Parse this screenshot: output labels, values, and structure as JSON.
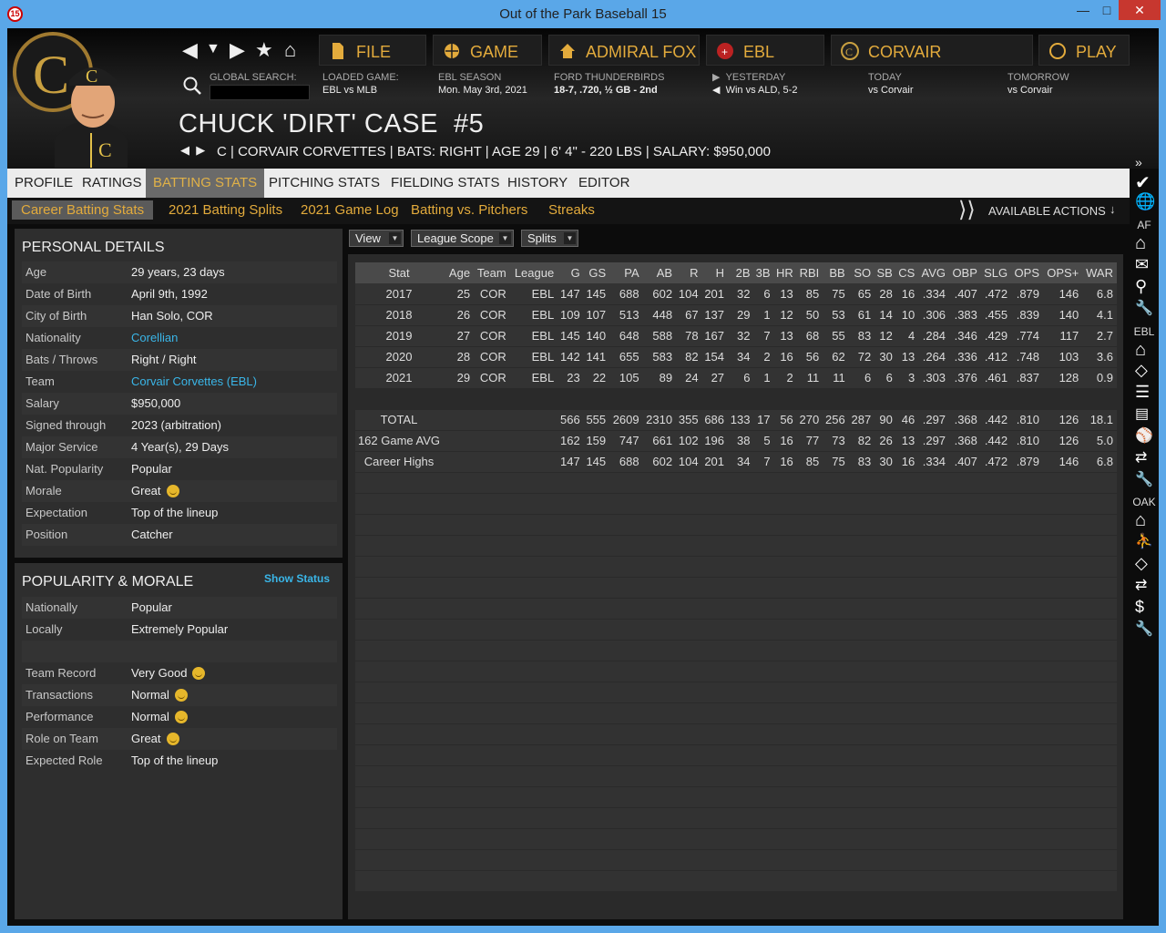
{
  "window": {
    "title": "Out of the Park Baseball 15",
    "app_icon": "15"
  },
  "menu": [
    {
      "label": "FILE",
      "icon": "file-icon"
    },
    {
      "label": "GAME",
      "icon": "globe-icon"
    },
    {
      "label": "ADMIRAL FOX",
      "icon": "home-icon"
    },
    {
      "label": "EBL",
      "icon": "league-logo-icon"
    },
    {
      "label": "CORVAIR",
      "icon": "team-logo-icon"
    },
    {
      "label": "PLAY",
      "icon": "play-icon"
    }
  ],
  "info": {
    "search_label": "GLOBAL SEARCH:",
    "loaded_label": "LOADED GAME:",
    "loaded_value": "EBL vs MLB",
    "season_label": "EBL SEASON",
    "season_value": "Mon. May 3rd, 2021",
    "team_label": "FORD THUNDERBIRDS",
    "team_value": "18-7, .720, ½ GB - 2nd",
    "yesterday_label": "YESTERDAY",
    "yesterday_value": "Win vs ALD, 5-2",
    "today_label": "TODAY",
    "today_value": "vs Corvair",
    "tomorrow_label": "TOMORROW",
    "tomorrow_value": "vs Corvair"
  },
  "player": {
    "name": "CHUCK 'DIRT' CASE  #5",
    "subtitle": "C | CORVAIR CORVETTES | BATS: RIGHT | AGE 29 | 6' 4\" - 220 LBS | SALARY: $950,000"
  },
  "tabs": [
    "PROFILE",
    "RATINGS",
    "BATTING STATS",
    "PITCHING STATS",
    "FIELDING STATS",
    "HISTORY",
    "EDITOR"
  ],
  "subtabs": [
    "Career Batting Stats",
    "2021 Batting Splits",
    "2021 Game Log",
    "Batting vs. Pitchers",
    "Streaks"
  ],
  "available_actions": "AVAILABLE ACTIONS",
  "personal": {
    "title": "PERSONAL DETAILS",
    "rows": [
      {
        "k": "Age",
        "v": "29 years, 23 days"
      },
      {
        "k": "Date of Birth",
        "v": "April 9th, 1992"
      },
      {
        "k": "City of Birth",
        "v": "Han Solo, COR"
      },
      {
        "k": "Nationality",
        "v": "Corellian"
      },
      {
        "k": "Bats / Throws",
        "v": "Right / Right"
      },
      {
        "k": "Team",
        "v": "Corvair Corvettes (EBL)"
      },
      {
        "k": "Salary",
        "v": "$950,000"
      },
      {
        "k": "Signed through",
        "v": "2023 (arbitration)"
      },
      {
        "k": "Major Service",
        "v": "4 Year(s), 29 Days"
      },
      {
        "k": "Nat. Popularity",
        "v": "Popular"
      },
      {
        "k": "Morale",
        "v": "Great"
      },
      {
        "k": "Expectation",
        "v": "Top of the lineup"
      },
      {
        "k": "Position",
        "v": "Catcher"
      }
    ]
  },
  "popularity": {
    "title": "POPULARITY & MORALE",
    "show_status": "Show Status",
    "rows": [
      {
        "k": "Nationally",
        "v": "Popular"
      },
      {
        "k": "Locally",
        "v": "Extremely Popular"
      },
      {
        "k": "",
        "v": ""
      },
      {
        "k": "Team Record",
        "v": "Very Good"
      },
      {
        "k": "Transactions",
        "v": "Normal"
      },
      {
        "k": "Performance",
        "v": "Normal"
      },
      {
        "k": "Role on Team",
        "v": "Great"
      },
      {
        "k": "Expected Role",
        "v": "Top of the lineup"
      }
    ]
  },
  "dropdowns": [
    "View",
    "League Scope",
    "Splits"
  ],
  "stats": {
    "headers": [
      "Stat",
      "Age",
      "Team",
      "League",
      "G",
      "GS",
      "PA",
      "AB",
      "R",
      "H",
      "2B",
      "3B",
      "HR",
      "RBI",
      "BB",
      "SO",
      "SB",
      "CS",
      "AVG",
      "OBP",
      "SLG",
      "OPS",
      "OPS+",
      "WAR"
    ],
    "rows": [
      [
        "2017",
        "25",
        "COR",
        "EBL",
        "147",
        "145",
        "688",
        "602",
        "104",
        "201",
        "32",
        "6",
        "13",
        "85",
        "75",
        "65",
        "28",
        "16",
        ".334",
        ".407",
        ".472",
        ".879",
        "146",
        "6.8"
      ],
      [
        "2018",
        "26",
        "COR",
        "EBL",
        "109",
        "107",
        "513",
        "448",
        "67",
        "137",
        "29",
        "1",
        "12",
        "50",
        "53",
        "61",
        "14",
        "10",
        ".306",
        ".383",
        ".455",
        ".839",
        "140",
        "4.1"
      ],
      [
        "2019",
        "27",
        "COR",
        "EBL",
        "145",
        "140",
        "648",
        "588",
        "78",
        "167",
        "32",
        "7",
        "13",
        "68",
        "55",
        "83",
        "12",
        "4",
        ".284",
        ".346",
        ".429",
        ".774",
        "117",
        "2.7"
      ],
      [
        "2020",
        "28",
        "COR",
        "EBL",
        "142",
        "141",
        "655",
        "583",
        "82",
        "154",
        "34",
        "2",
        "16",
        "56",
        "62",
        "72",
        "30",
        "13",
        ".264",
        ".336",
        ".412",
        ".748",
        "103",
        "3.6"
      ],
      [
        "2021",
        "29",
        "COR",
        "EBL",
        "23",
        "22",
        "105",
        "89",
        "24",
        "27",
        "6",
        "1",
        "2",
        "11",
        "11",
        "6",
        "6",
        "3",
        ".303",
        ".376",
        ".461",
        ".837",
        "128",
        "0.9"
      ],
      [
        "",
        "",
        "",
        "",
        "",
        "",
        "",
        "",
        "",
        "",
        "",
        "",
        "",
        "",
        "",
        "",
        "",
        "",
        "",
        "",
        "",
        "",
        "",
        ""
      ],
      [
        "TOTAL",
        "",
        "",
        "",
        "566",
        "555",
        "2609",
        "2310",
        "355",
        "686",
        "133",
        "17",
        "56",
        "270",
        "256",
        "287",
        "90",
        "46",
        ".297",
        ".368",
        ".442",
        ".810",
        "126",
        "18.1"
      ],
      [
        "162 Game AVG",
        "",
        "",
        "",
        "162",
        "159",
        "747",
        "661",
        "102",
        "196",
        "38",
        "5",
        "16",
        "77",
        "73",
        "82",
        "26",
        "13",
        ".297",
        ".368",
        ".442",
        ".810",
        "126",
        "5.0"
      ],
      [
        "Career Highs",
        "",
        "",
        "",
        "147",
        "145",
        "688",
        "602",
        "104",
        "201",
        "34",
        "7",
        "16",
        "85",
        "75",
        "83",
        "30",
        "16",
        ".334",
        ".407",
        ".472",
        ".879",
        "146",
        "6.8"
      ]
    ]
  },
  "sidebar": {
    "labels": [
      "AF",
      "EBL",
      "OAK"
    ]
  }
}
